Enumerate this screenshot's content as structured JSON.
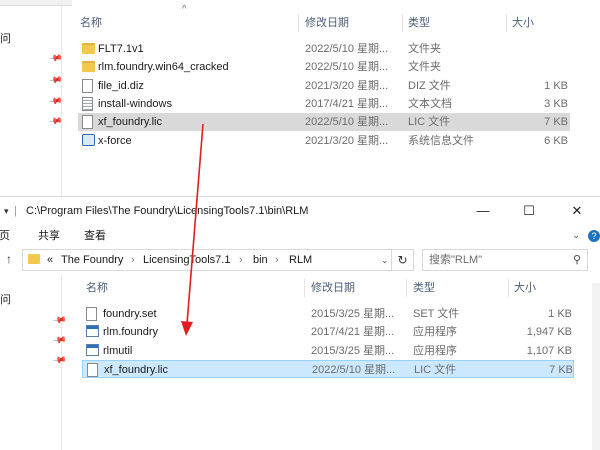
{
  "top_window": {
    "columns": {
      "name": "名称",
      "date": "修改日期",
      "type": "类型",
      "size": "大小"
    },
    "sort_glyph": "^",
    "nav_fragment": "问",
    "files": [
      {
        "name": "FLT7.1v1",
        "date": "2022/5/10 星期...",
        "type": "文件夹",
        "size": "",
        "icon": "folder-icon"
      },
      {
        "name": "rlm.foundry.win64_cracked",
        "date": "2022/5/10 星期...",
        "type": "文件夹",
        "size": "",
        "icon": "folder-icon"
      },
      {
        "name": "file_id.diz",
        "date": "2021/3/20 星期...",
        "type": "DIZ 文件",
        "size": "1 KB",
        "icon": "file-icon"
      },
      {
        "name": "install-windows",
        "date": "2017/4/21 星期...",
        "type": "文本文档",
        "size": "3 KB",
        "icon": "text-document-icon"
      },
      {
        "name": "xf_foundry.lic",
        "date": "2022/5/10 星期...",
        "type": "LIC 文件",
        "size": "7 KB",
        "icon": "file-icon"
      },
      {
        "name": "x-force",
        "date": "2021/3/20 星期...",
        "type": "系统信息文件",
        "size": "6 KB",
        "icon": "system-info-icon"
      }
    ]
  },
  "bottom_window": {
    "title": "C:\\Program Files\\The Foundry\\LicensingTools7.1\\bin\\RLM",
    "controls": {
      "minimize": "—",
      "maximize": "☐",
      "close": "✕"
    },
    "ribbon": {
      "fragment": "主页",
      "share": "共享",
      "view": "查看"
    },
    "address": {
      "chevrons": "«",
      "crumbs": [
        "The Foundry",
        "LicensingTools7.1",
        "bin",
        "RLM"
      ],
      "separator": "›"
    },
    "search_placeholder": "搜索\"RLM\"",
    "columns": {
      "name": "名称",
      "date": "修改日期",
      "type": "类型",
      "size": "大小"
    },
    "nav_fragment": "问",
    "files": [
      {
        "name": "foundry.set",
        "date": "2015/3/25 星期...",
        "type": "SET 文件",
        "size": "1 KB",
        "icon": "file-icon"
      },
      {
        "name": "rlm.foundry",
        "date": "2017/4/21 星期...",
        "type": "应用程序",
        "size": "1,947 KB",
        "icon": "application-icon"
      },
      {
        "name": "rlmutil",
        "date": "2015/3/25 星期...",
        "type": "应用程序",
        "size": "1,107 KB",
        "icon": "application-icon"
      },
      {
        "name": "xf_foundry.lic",
        "date": "2022/5/10 星期...",
        "type": "LIC 文件",
        "size": "7 KB",
        "icon": "file-icon"
      }
    ]
  },
  "colors": {
    "arrow": "#e02020",
    "selection_gray": "#d9d9d9",
    "selection_blue": "#cce8ff",
    "header_text": "#4c607a",
    "folder": "#f2c94c"
  }
}
